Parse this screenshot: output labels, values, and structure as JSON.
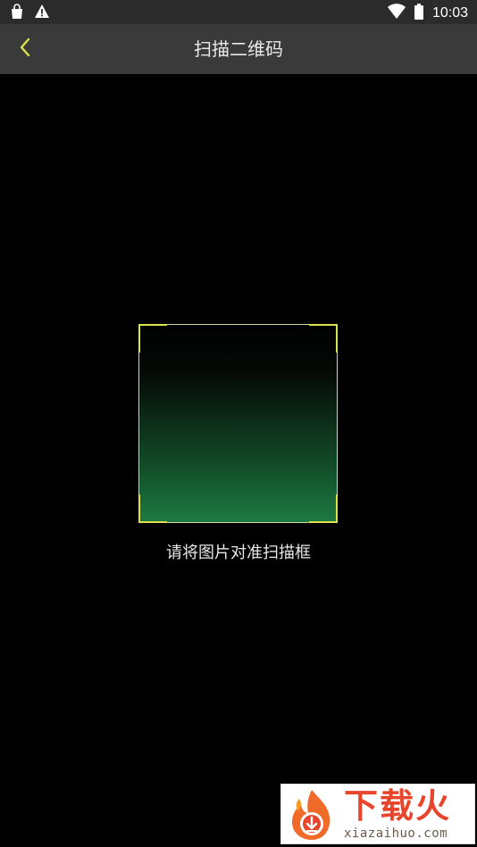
{
  "status_bar": {
    "time": "10:03",
    "icons": [
      "shopping-bag-icon",
      "warning-icon",
      "wifi-icon",
      "battery-icon"
    ]
  },
  "app_bar": {
    "title": "扫描二维码",
    "back_icon": "chevron-left-icon"
  },
  "scanner": {
    "hint": "请将图片对准扫描框"
  },
  "watermark": {
    "title": "下载火",
    "subtitle": "xiazaihuo.com"
  },
  "colors": {
    "accent": "#dce24a",
    "scan_green": "#1c7a42",
    "app_bar_bg": "#3a3a3a",
    "status_bar_bg": "#2b2b2b",
    "watermark_red": "#e8452c"
  }
}
